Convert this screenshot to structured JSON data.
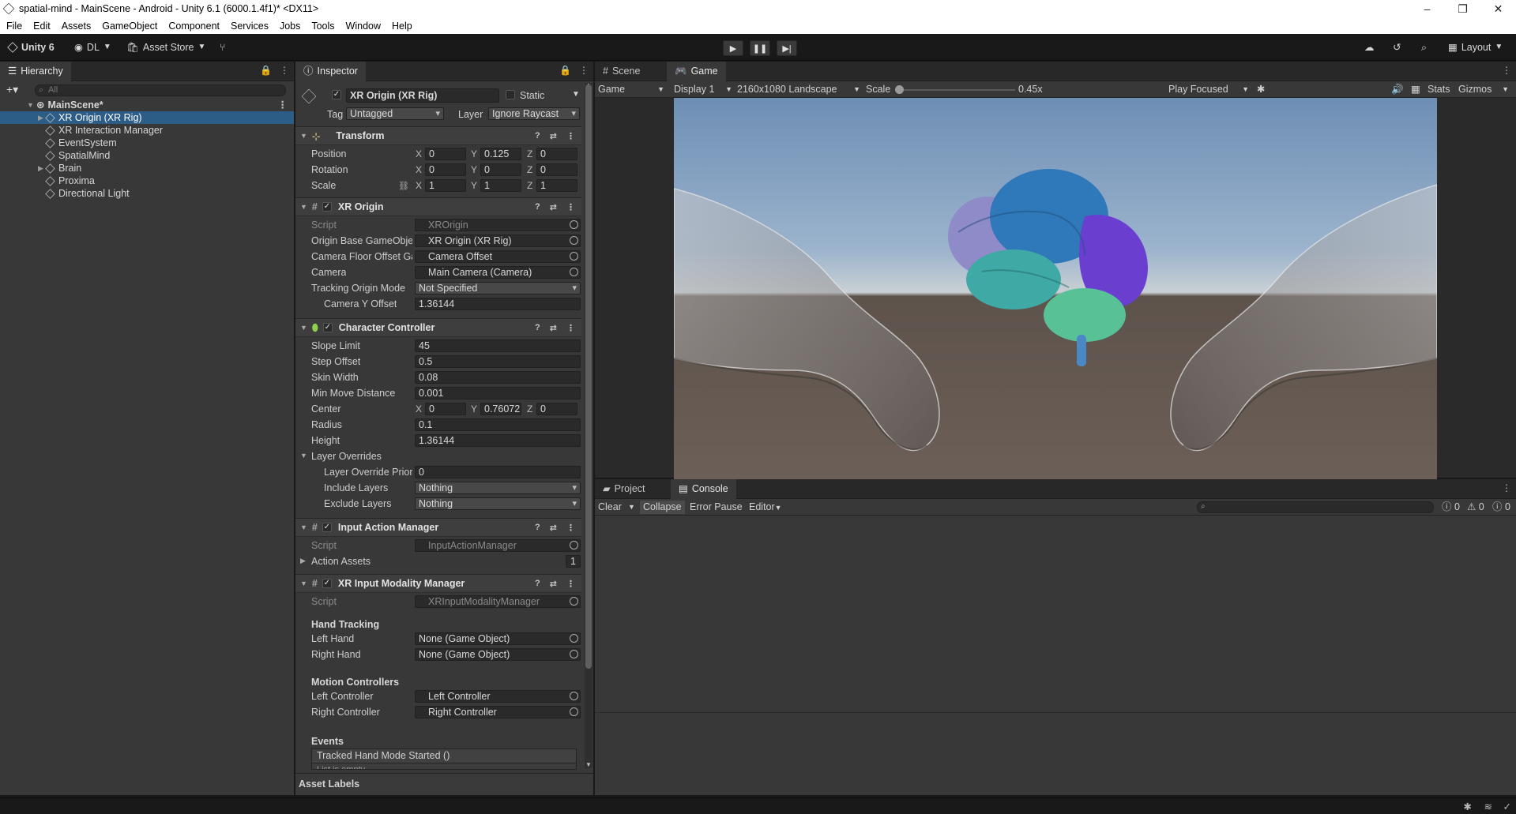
{
  "window": {
    "title": "spatial-mind - MainScene - Android - Unity 6.1 (6000.1.4f1)* <DX11>",
    "minimize": "–",
    "maximize": "❐",
    "close": "✕"
  },
  "menu": [
    "File",
    "Edit",
    "Assets",
    "GameObject",
    "Component",
    "Services",
    "Jobs",
    "Tools",
    "Window",
    "Help"
  ],
  "toolbar": {
    "unity": "Unity 6",
    "account": "DL",
    "asset_store": "Asset Store",
    "layout": "Layout"
  },
  "hierarchy": {
    "tab": "Hierarchy",
    "search_placeholder": "All",
    "scene": "MainScene*",
    "items": [
      {
        "label": "XR Origin (XR Rig)",
        "selected": true,
        "foldout": true
      },
      {
        "label": "XR Interaction Manager"
      },
      {
        "label": "EventSystem"
      },
      {
        "label": "SpatialMind"
      },
      {
        "label": "Brain",
        "foldout": true
      },
      {
        "label": "Proxima"
      },
      {
        "label": "Directional Light"
      }
    ]
  },
  "inspector": {
    "tab": "Inspector",
    "object_name": "XR Origin (XR Rig)",
    "static": "Static",
    "tag_label": "Tag",
    "tag": "Untagged",
    "layer_label": "Layer",
    "layer": "Ignore Raycast",
    "transform": {
      "title": "Transform",
      "position_label": "Position",
      "rotation_label": "Rotation",
      "scale_label": "Scale",
      "position": [
        "0",
        "0.125",
        "0"
      ],
      "rotation": [
        "0",
        "0",
        "0"
      ],
      "scale": [
        "1",
        "1",
        "1"
      ]
    },
    "xr_origin": {
      "title": "XR Origin",
      "script_label": "Script",
      "script": "XROrigin",
      "origin_base_label": "Origin Base GameObje",
      "origin_base": "XR Origin (XR Rig)",
      "camera_floor_label": "Camera Floor Offset Ga",
      "camera_floor": "Camera Offset",
      "camera_label": "Camera",
      "camera": "Main Camera (Camera)",
      "tracking_label": "Tracking Origin Mode",
      "tracking": "Not Specified",
      "cam_y_label": "Camera Y Offset",
      "cam_y": "1.36144"
    },
    "character_controller": {
      "title": "Character Controller",
      "slope_label": "Slope Limit",
      "slope": "45",
      "step_label": "Step Offset",
      "step": "0.5",
      "skin_label": "Skin Width",
      "skin": "0.08",
      "minmove_label": "Min Move Distance",
      "minmove": "0.001",
      "center_label": "Center",
      "center": [
        "0",
        "0.76072",
        "0"
      ],
      "radius_label": "Radius",
      "radius": "0.1",
      "height_label": "Height",
      "height": "1.36144",
      "overrides_label": "Layer Overrides",
      "priority_label": "Layer Override Prior",
      "priority": "0",
      "include_label": "Include Layers",
      "include": "Nothing",
      "exclude_label": "Exclude Layers",
      "exclude": "Nothing"
    },
    "input_action": {
      "title": "Input Action Manager",
      "script_label": "Script",
      "script": "InputActionManager",
      "assets_label": "Action Assets",
      "assets_count": "1"
    },
    "modality": {
      "title": "XR Input Modality Manager",
      "script_label": "Script",
      "script": "XRInputModalityManager",
      "hand_head": "Hand Tracking",
      "left_hand_label": "Left Hand",
      "left_hand": "None (Game Object)",
      "right_hand_label": "Right Hand",
      "right_hand": "None (Game Object)",
      "motion_head": "Motion Controllers",
      "left_ctrl_label": "Left Controller",
      "left_ctrl": "Left Controller",
      "right_ctrl_label": "Right Controller",
      "right_ctrl": "Right Controller",
      "events_head": "Events",
      "event1": "Tracked Hand Mode Started ()",
      "event2": "List is empty"
    },
    "asset_labels": "Asset Labels"
  },
  "game": {
    "tab_scene": "Scene",
    "tab_game": "Game",
    "mode": "Game",
    "display": "Display 1",
    "resolution": "2160x1080 Landscape",
    "scale_label": "Scale",
    "scale_value": "0.45x",
    "play_mode": "Play Focused",
    "stats": "Stats",
    "gizmos": "Gizmos"
  },
  "console": {
    "tab_project": "Project",
    "tab_console": "Console",
    "clear": "Clear",
    "collapse": "Collapse",
    "error_pause": "Error Pause",
    "editor": "Editor",
    "count_info": "0",
    "count_warn": "0",
    "count_error": "0"
  },
  "colors": {
    "selection": "#2c5d87",
    "panel": "#383838",
    "brain_purple": "#6a3fd0",
    "brain_blue": "#2f78b9",
    "brain_teal": "#3fa9a6",
    "brain_green": "#58c296"
  }
}
